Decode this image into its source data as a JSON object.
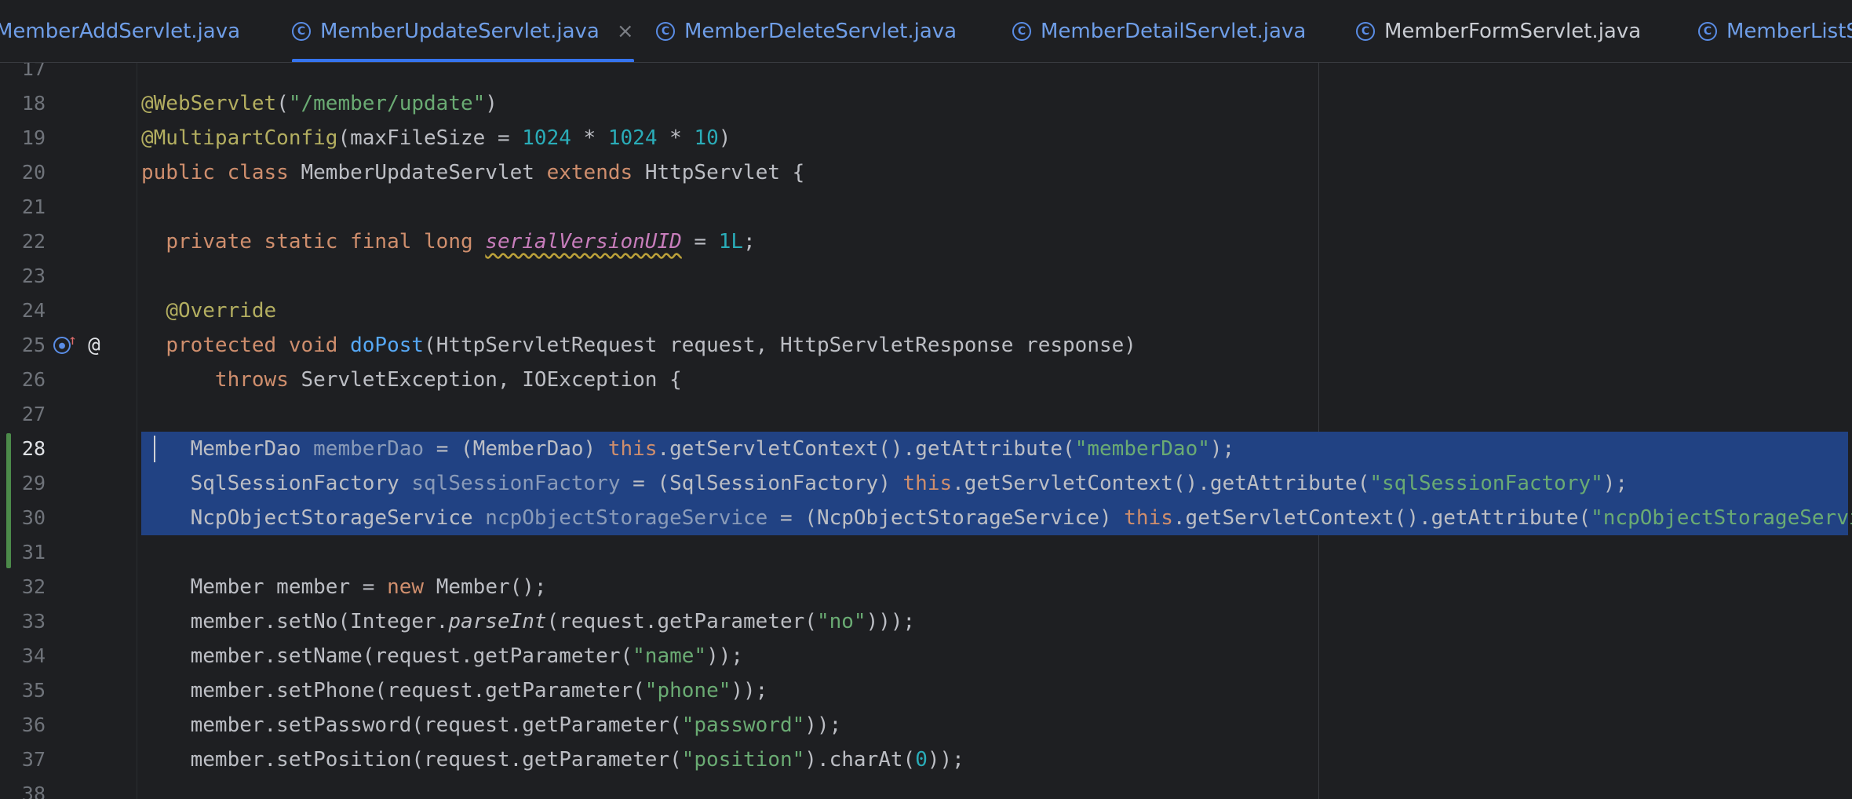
{
  "tabs": [
    {
      "label": "MemberAddServlet.java",
      "active": false,
      "closable": false
    },
    {
      "label": "MemberUpdateServlet.java",
      "active": true,
      "closable": true,
      "close_glyph": "×"
    },
    {
      "label": "MemberDeleteServlet.java",
      "active": false,
      "closable": false
    },
    {
      "label": "MemberDetailServlet.java",
      "active": false,
      "closable": false
    },
    {
      "label": "MemberFormServlet.java",
      "active": false,
      "closable": false
    },
    {
      "label": "MemberListServlet.java",
      "active": false,
      "closable": false
    }
  ],
  "tab_icon_glyph": "C",
  "gutter_icons": {
    "implements_icon": "override-method-icon",
    "annotation_icon_glyph": "@"
  },
  "editor": {
    "current_line": 28,
    "selected_lines": [
      28,
      29,
      30
    ],
    "changed_lines": [
      28,
      29,
      30,
      31
    ],
    "lines": [
      {
        "n": "17",
        "tokens": []
      },
      {
        "n": "18",
        "tokens": [
          [
            "ann",
            "@WebServlet"
          ],
          [
            "p",
            "("
          ],
          [
            "str",
            "\"/member/update\""
          ],
          [
            "p",
            ")"
          ]
        ]
      },
      {
        "n": "19",
        "tokens": [
          [
            "ann",
            "@MultipartConfig"
          ],
          [
            "p",
            "(maxFileSize = "
          ],
          [
            "num",
            "1024"
          ],
          [
            "p",
            " * "
          ],
          [
            "num",
            "1024"
          ],
          [
            "p",
            " * "
          ],
          [
            "num",
            "10"
          ],
          [
            "p",
            ")"
          ]
        ]
      },
      {
        "n": "20",
        "tokens": [
          [
            "kw",
            "public class "
          ],
          [
            "p",
            "MemberUpdateServlet "
          ],
          [
            "kw",
            "extends "
          ],
          [
            "p",
            "HttpServlet {"
          ]
        ]
      },
      {
        "n": "21",
        "tokens": []
      },
      {
        "n": "22",
        "tokens": [
          [
            "p",
            "  "
          ],
          [
            "kw",
            "private static final long "
          ],
          [
            "field",
            "serialVersionUID"
          ],
          [
            "p",
            " = "
          ],
          [
            "num",
            "1L"
          ],
          [
            "p",
            ";"
          ]
        ]
      },
      {
        "n": "23",
        "tokens": []
      },
      {
        "n": "24",
        "tokens": [
          [
            "p",
            "  "
          ],
          [
            "ann",
            "@Override"
          ]
        ]
      },
      {
        "n": "25",
        "tokens": [
          [
            "p",
            "  "
          ],
          [
            "kw",
            "protected void "
          ],
          [
            "fn",
            "doPost"
          ],
          [
            "p",
            "(HttpServletRequest request, HttpServletResponse response)"
          ]
        ]
      },
      {
        "n": "26",
        "tokens": [
          [
            "p",
            "      "
          ],
          [
            "kw",
            "throws "
          ],
          [
            "p",
            "ServletException, IOException {"
          ]
        ]
      },
      {
        "n": "27",
        "tokens": []
      },
      {
        "n": "28",
        "tokens": [
          [
            "p",
            "    MemberDao "
          ],
          [
            "su",
            "memberDao"
          ],
          [
            "p",
            " = (MemberDao) "
          ],
          [
            "kw",
            "this"
          ],
          [
            "p",
            ".getServletContext().getAttribute("
          ],
          [
            "str",
            "\"memberDao\""
          ],
          [
            "p",
            ");"
          ]
        ]
      },
      {
        "n": "29",
        "tokens": [
          [
            "p",
            "    SqlSessionFactory "
          ],
          [
            "su",
            "sqlSessionFactory"
          ],
          [
            "p",
            " = (SqlSessionFactory) "
          ],
          [
            "kw",
            "this"
          ],
          [
            "p",
            ".getServletContext().getAttribute("
          ],
          [
            "str",
            "\"sqlSessionFactory\""
          ],
          [
            "p",
            ");"
          ]
        ]
      },
      {
        "n": "30",
        "tokens": [
          [
            "p",
            "    NcpObjectStorageService "
          ],
          [
            "su",
            "ncpObjectStorageService"
          ],
          [
            "p",
            " = (NcpObjectStorageService) "
          ],
          [
            "kw",
            "this"
          ],
          [
            "p",
            ".getServletContext().getAttribute("
          ],
          [
            "str",
            "\"ncpObjectStorageService\""
          ],
          [
            "p",
            ");"
          ]
        ]
      },
      {
        "n": "31",
        "tokens": []
      },
      {
        "n": "32",
        "tokens": [
          [
            "p",
            "    Member member = "
          ],
          [
            "kw",
            "new "
          ],
          [
            "p",
            "Member();"
          ]
        ]
      },
      {
        "n": "33",
        "tokens": [
          [
            "p",
            "    member.setNo(Integer."
          ],
          [
            "it",
            "parseInt"
          ],
          [
            "p",
            "(request.getParameter("
          ],
          [
            "str",
            "\"no\""
          ],
          [
            "p",
            ")));"
          ]
        ]
      },
      {
        "n": "34",
        "tokens": [
          [
            "p",
            "    member.setName(request.getParameter("
          ],
          [
            "str",
            "\"name\""
          ],
          [
            "p",
            "));"
          ]
        ]
      },
      {
        "n": "35",
        "tokens": [
          [
            "p",
            "    member.setPhone(request.getParameter("
          ],
          [
            "str",
            "\"phone\""
          ],
          [
            "p",
            "));"
          ]
        ]
      },
      {
        "n": "36",
        "tokens": [
          [
            "p",
            "    member.setPassword(request.getParameter("
          ],
          [
            "str",
            "\"password\""
          ],
          [
            "p",
            "));"
          ]
        ]
      },
      {
        "n": "37",
        "tokens": [
          [
            "p",
            "    member.setPosition(request.getParameter("
          ],
          [
            "str",
            "\"position\""
          ],
          [
            "p",
            ").charAt("
          ],
          [
            "num",
            "0"
          ],
          [
            "p",
            "));"
          ]
        ]
      },
      {
        "n": "38",
        "tokens": []
      }
    ]
  },
  "colors": {
    "background": "#1e1f22",
    "keyword": "#cf8e6d",
    "string": "#6aab73",
    "number": "#2aacb8",
    "annotation": "#b3ae60",
    "function": "#56a8f5",
    "selection": "#214283",
    "tab_accent": "#3574f0"
  }
}
